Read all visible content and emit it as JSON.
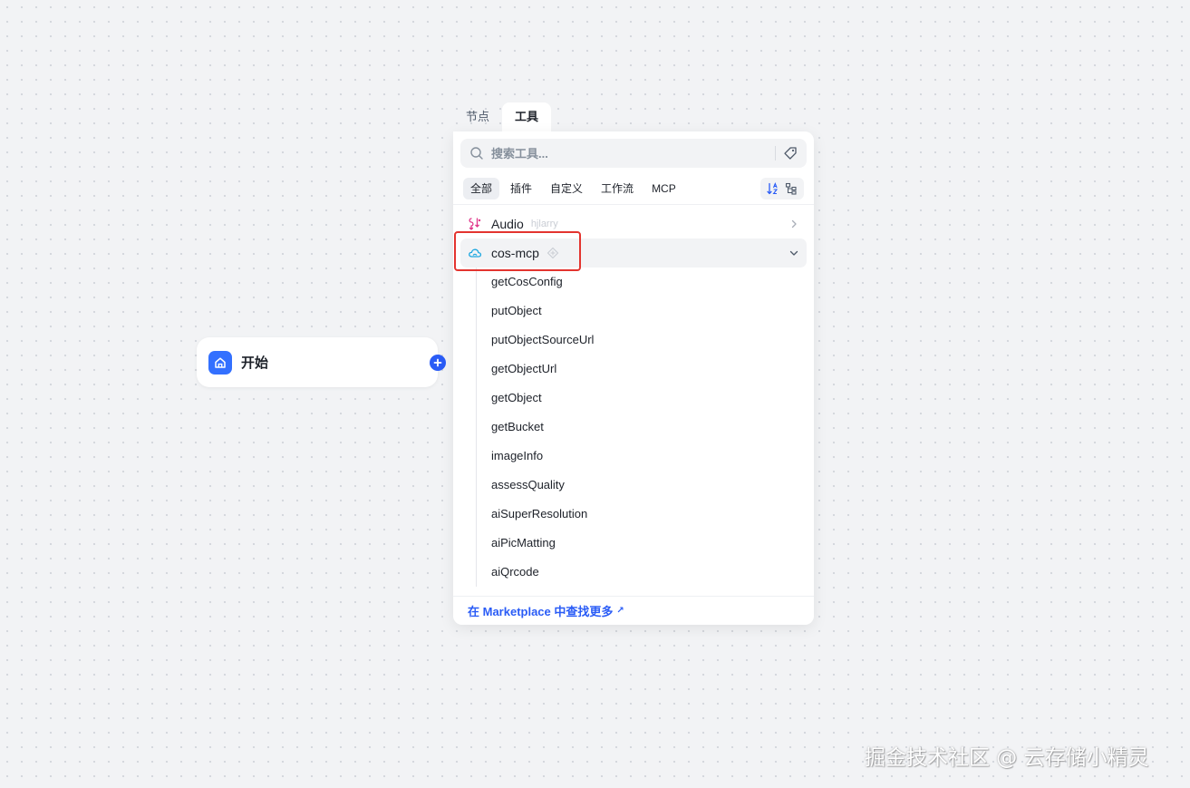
{
  "canvas": {
    "start_node": {
      "label": "开始"
    }
  },
  "panel": {
    "tabs": [
      {
        "label": "节点",
        "active": false
      },
      {
        "label": "工具",
        "active": true
      }
    ],
    "search": {
      "placeholder": "搜索工具...",
      "value": ""
    },
    "filters": [
      {
        "label": "全部",
        "active": true
      },
      {
        "label": "插件",
        "active": false
      },
      {
        "label": "自定义",
        "active": false
      },
      {
        "label": "工作流",
        "active": false
      },
      {
        "label": "MCP",
        "active": false
      }
    ],
    "groups": [
      {
        "name": "Audio",
        "author": "hjlarry",
        "expanded": false,
        "icon": "audio-icon"
      },
      {
        "name": "cos-mcp",
        "author": "",
        "expanded": true,
        "icon": "cloud-icon",
        "tools": [
          "getCosConfig",
          "putObject",
          "putObjectSourceUrl",
          "getObjectUrl",
          "getObject",
          "getBucket",
          "imageInfo",
          "assessQuality",
          "aiSuperResolution",
          "aiPicMatting",
          "aiQrcode"
        ]
      }
    ],
    "footer": {
      "link_label": "在 Marketplace 中查找更多",
      "arrow": "↗"
    }
  },
  "watermark": "掘金技术社区 @ 云存储小精灵",
  "colors": {
    "accent": "#2a5cf6",
    "highlight": "#e3342f",
    "start_icon_bg": "#3370ff"
  }
}
